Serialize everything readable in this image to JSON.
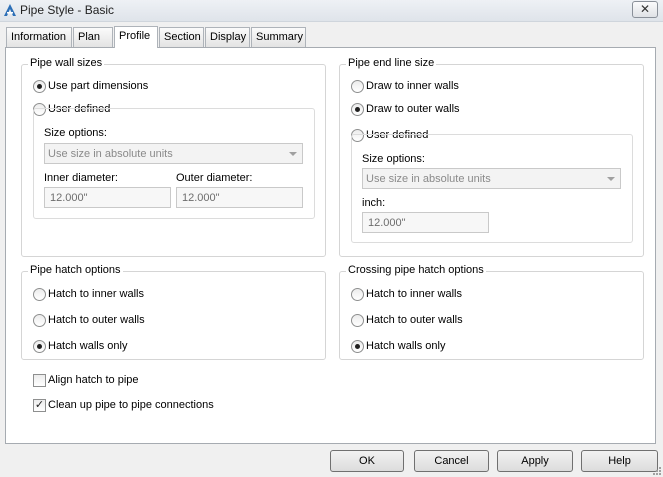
{
  "window": {
    "title": "Pipe Style - Basic",
    "close_glyph": "✕",
    "icon": "autocad-a-icon"
  },
  "tabs": [
    {
      "label": "Information",
      "active": false
    },
    {
      "label": "Plan",
      "active": false
    },
    {
      "label": "Profile",
      "active": true
    },
    {
      "label": "Section",
      "active": false
    },
    {
      "label": "Display",
      "active": false
    },
    {
      "label": "Summary",
      "active": false
    }
  ],
  "pipe_wall_sizes": {
    "title": "Pipe wall sizes",
    "use_part_dimensions": {
      "label": "Use part dimensions",
      "selected": true
    },
    "user_defined": {
      "label": "User defined",
      "selected": false
    },
    "size_options_label": "Size options:",
    "size_options_value": "Use size in absolute units",
    "inner_diameter_label": "Inner diameter:",
    "inner_diameter_value": "12.000\"",
    "outer_diameter_label": "Outer diameter:",
    "outer_diameter_value": "12.000\""
  },
  "pipe_end_line_size": {
    "title": "Pipe end line size",
    "draw_inner": {
      "label": "Draw to inner walls",
      "selected": false
    },
    "draw_outer": {
      "label": "Draw to outer walls",
      "selected": true
    },
    "user_defined": {
      "label": "User defined",
      "selected": false
    },
    "size_options_label": "Size options:",
    "size_options_value": "Use size in absolute units",
    "inch_label": "inch:",
    "inch_value": "12.000\""
  },
  "pipe_hatch_options": {
    "title": "Pipe hatch options",
    "inner": {
      "label": "Hatch to inner walls",
      "selected": false
    },
    "outer": {
      "label": "Hatch to outer walls",
      "selected": false
    },
    "walls_only": {
      "label": "Hatch walls only",
      "selected": true
    }
  },
  "crossing_pipe_hatch_options": {
    "title": "Crossing pipe hatch options",
    "inner": {
      "label": "Hatch to inner walls",
      "selected": false
    },
    "outer": {
      "label": "Hatch to outer walls",
      "selected": false
    },
    "walls_only": {
      "label": "Hatch walls only",
      "selected": true
    }
  },
  "align_hatch": {
    "label": "Align hatch to pipe",
    "checked": false
  },
  "clean_up": {
    "label": "Clean up pipe to pipe connections",
    "checked": true,
    "check_glyph": "✓"
  },
  "buttons": {
    "ok": "OK",
    "cancel": "Cancel",
    "apply": "Apply",
    "help": "Help"
  }
}
